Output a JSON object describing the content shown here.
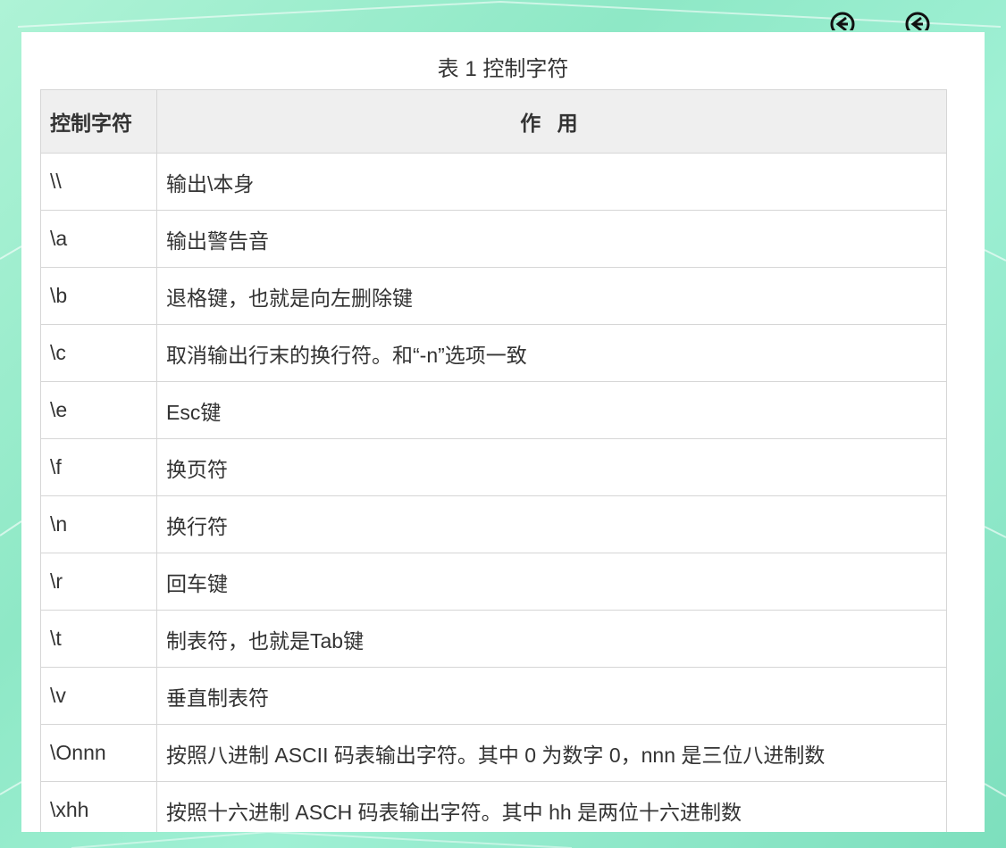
{
  "table": {
    "caption": "表 1 控制字符",
    "headers": {
      "control_char": "控制字符",
      "purpose": "作 用"
    },
    "rows": [
      {
        "char": "\\\\",
        "purpose": "输出\\本身"
      },
      {
        "char": "\\a",
        "purpose": "输出警告音"
      },
      {
        "char": "\\b",
        "purpose": "退格键，也就是向左删除键"
      },
      {
        "char": "\\c",
        "purpose": "取消输出行末的换行符。和“-n”选项一致"
      },
      {
        "char": "\\e",
        "purpose": "Esc键"
      },
      {
        "char": "\\f",
        "purpose": "换页符"
      },
      {
        "char": "\\n",
        "purpose": "换行符"
      },
      {
        "char": "\\r",
        "purpose": "回车键"
      },
      {
        "char": "\\t",
        "purpose": "制表符，也就是Tab键"
      },
      {
        "char": "\\v",
        "purpose": "垂直制表符"
      },
      {
        "char": "\\Onnn",
        "purpose": "按照八进制 ASCII 码表输出字符。其中 0 为数字 0，nnn 是三位八进制数"
      },
      {
        "char": "\\xhh",
        "purpose": "按照十六进制 ASCH 码表输出字符。其中 hh 是两位十六进制数"
      }
    ]
  },
  "icons": [
    "circled-arrow-icon",
    "circled-arrow-icon"
  ],
  "colors": {
    "background": "#9ff0d4",
    "header_bg": "#efefef",
    "border": "#d6d6d6",
    "text": "#333333"
  }
}
